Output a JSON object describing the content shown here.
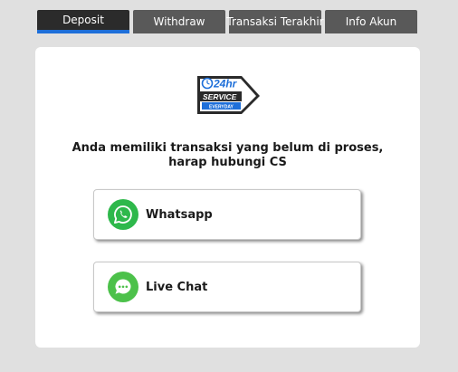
{
  "tabs": [
    {
      "label": "Deposit",
      "active": true
    },
    {
      "label": "Withdraw",
      "active": false
    },
    {
      "label": "Transaksi Terakhir",
      "active": false
    },
    {
      "label": "Info Akun",
      "active": false
    }
  ],
  "logo": {
    "hours": "24hr",
    "service": "SERVICE",
    "everyday": "EVERYDAY",
    "icon": "service-24hr-icon"
  },
  "message": "Anda memiliki transaksi yang belum di proses, harap hubungi CS",
  "contacts": [
    {
      "label": "Whatsapp",
      "icon": "whatsapp-icon",
      "color": "#2eb84b"
    },
    {
      "label": "Live Chat",
      "icon": "live-chat-icon",
      "color": "#4cc14a"
    }
  ],
  "colors": {
    "active_tab_underline": "#1e6fd9",
    "tab_background": "#595959",
    "active_tab_background": "#2b2b2b"
  }
}
